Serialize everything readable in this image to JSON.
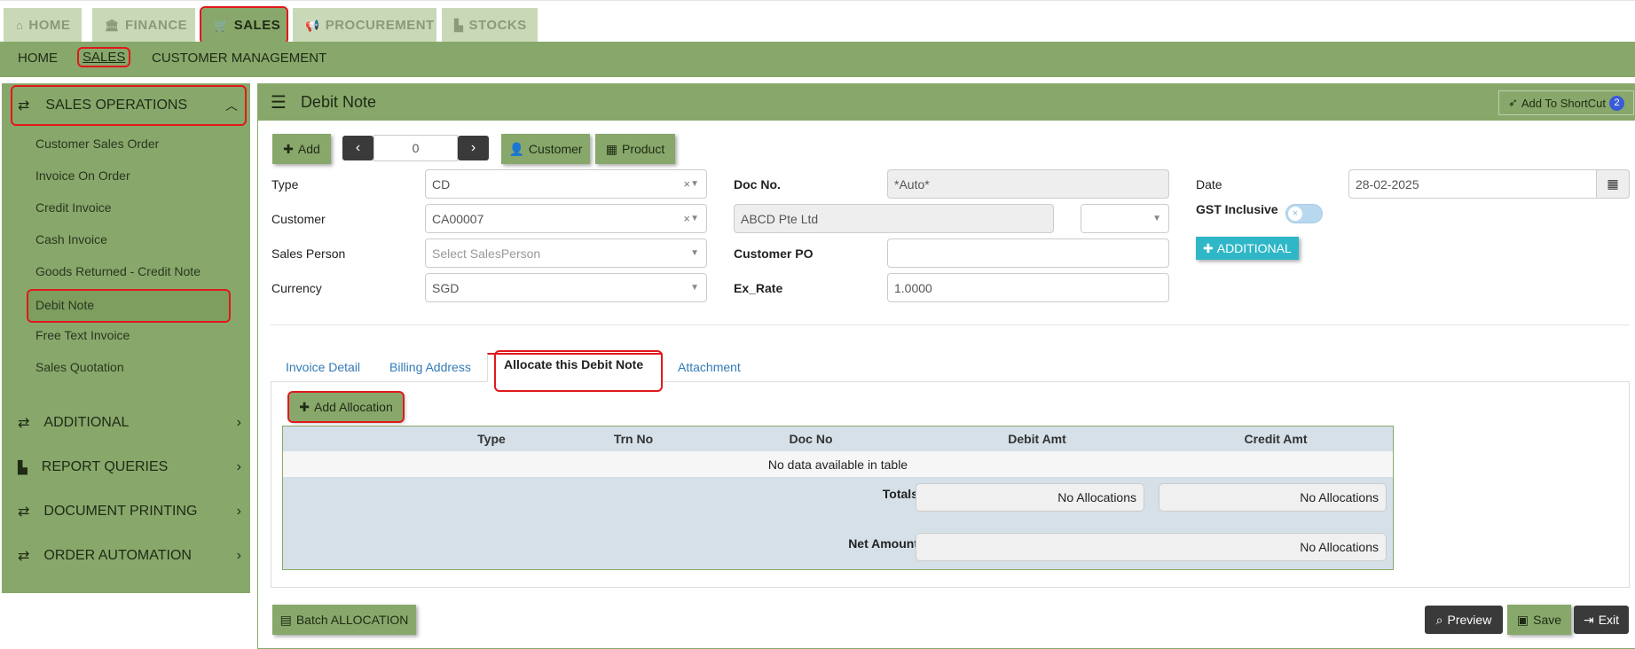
{
  "top_tabs": [
    {
      "label": "HOME",
      "icon": "home-icon"
    },
    {
      "label": "FINANCE",
      "icon": "bank-icon"
    },
    {
      "label": "SALES",
      "icon": "cart-icon"
    },
    {
      "label": "PROCUREMENT",
      "icon": "megaphone-icon"
    },
    {
      "label": "STOCKS",
      "icon": "bar-chart-icon"
    }
  ],
  "sub_nav": [
    "HOME",
    "SALES",
    "CUSTOMER MANAGEMENT"
  ],
  "sidebar": {
    "header": "SALES OPERATIONS",
    "items": [
      "Customer Sales Order",
      "Invoice On Order",
      "Credit Invoice",
      "Cash Invoice",
      "Goods Returned - Credit Note",
      "Debit Note",
      "Free Text Invoice",
      "Sales Quotation"
    ],
    "sections": [
      "ADDITIONAL",
      "REPORT QUERIES",
      "DOCUMENT PRINTING",
      "ORDER AUTOMATION"
    ]
  },
  "panel": {
    "title": "Debit Note",
    "shortcut_label": "Add To ShortCut",
    "shortcut_count": "2"
  },
  "toolbar": {
    "add_label": "Add",
    "record_value": "0",
    "customer_label": "Customer",
    "product_label": "Product"
  },
  "form": {
    "type_label": "Type",
    "type_value": "CD",
    "customer_label": "Customer",
    "customer_value": "CA00007",
    "salesperson_label": "Sales Person",
    "salesperson_placeholder": "Select SalesPerson",
    "currency_label": "Currency",
    "currency_value": "SGD",
    "docno_label": "Doc No.",
    "docno_value": "*Auto*",
    "customer_name_value": "ABCD Pte Ltd",
    "customer_po_label": "Customer PO",
    "customer_po_value": "",
    "exrate_label": "Ex_Rate",
    "exrate_value": "1.0000",
    "date_label": "Date",
    "date_value": "28-02-2025",
    "gst_label": "GST Inclusive",
    "additional_label": "ADDITIONAL"
  },
  "tabs": [
    "Invoice Detail",
    "Billing Address",
    "Allocate this Debit Note",
    "Attachment"
  ],
  "allocation": {
    "add_label": "Add Allocation",
    "columns": [
      "Type",
      "Trn No",
      "Doc No",
      "Debit Amt",
      "Credit Amt"
    ],
    "empty_text": "No data available in table",
    "totals_label": "Totals",
    "totals_debit": "No Allocations",
    "totals_credit": "No Allocations",
    "net_label": "Net Amount",
    "net_value": "No Allocations"
  },
  "footer": {
    "batch_label": "Batch ALLOCATION",
    "preview_label": "Preview",
    "save_label": "Save",
    "exit_label": "Exit"
  },
  "colors": {
    "theme_green": "#88a86b",
    "highlight_red": "#e0191c",
    "tab_link_blue": "#337ab7",
    "additional_cyan": "#2fb7c7"
  }
}
